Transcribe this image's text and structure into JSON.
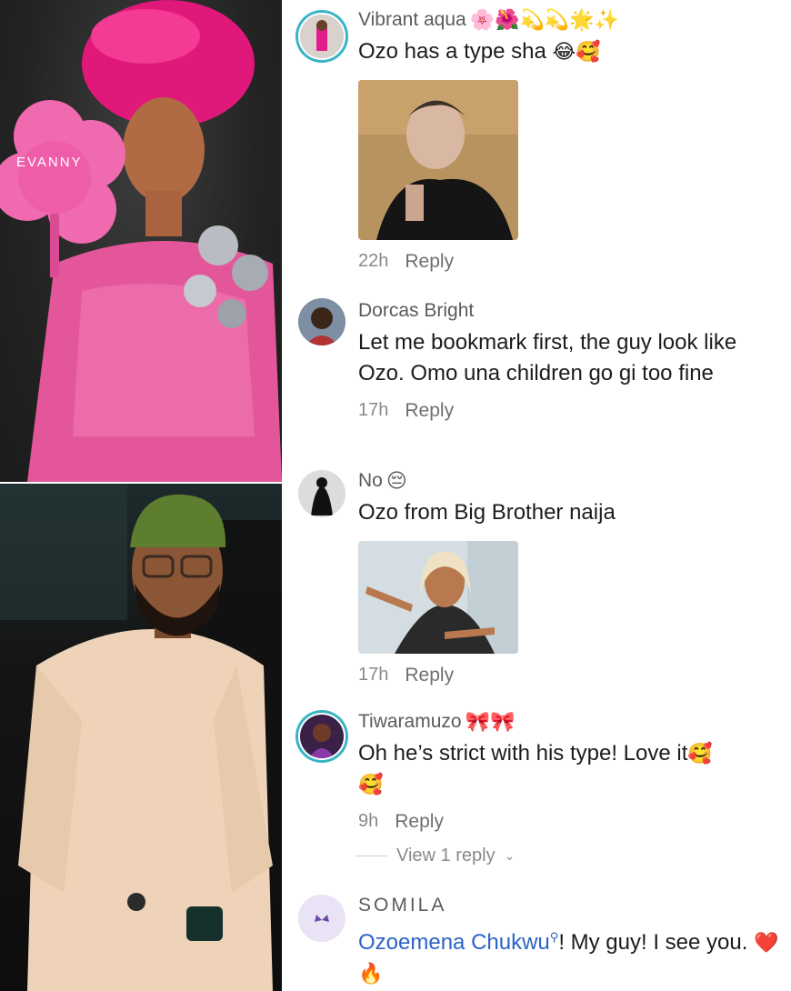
{
  "left_panel": {
    "top_photo_caption": "EVANNY"
  },
  "comments": [
    {
      "username": "Vibrant aqua",
      "username_emojis": "🌸🌺💫💫🌟✨",
      "text": "Ozo has a type sha",
      "text_emojis": "😂🥰",
      "time": "22h",
      "reply_label": "Reply"
    },
    {
      "username": "Dorcas Bright",
      "text": "Let me bookmark first, the guy look like Ozo. Omo una children go gi too fine",
      "time": "17h",
      "reply_label": "Reply"
    },
    {
      "username": "No",
      "username_emojis": "😔",
      "text": "Ozo from Big Brother naija",
      "time": "17h",
      "reply_label": "Reply"
    },
    {
      "username": "Tiwaramuzo",
      "username_emojis": "🎀🎀",
      "text": "Oh he’s strict with his type! Love it",
      "text_emojis": "🥰",
      "text_emojis_line2": "🥰",
      "time": "9h",
      "reply_label": "Reply",
      "view_replies": "View 1 reply"
    },
    {
      "username": "SOMILA",
      "mention": "Ozoemena Chukwu",
      "text": "! My guy! I see you.",
      "text_emojis": "❤️🔥"
    }
  ],
  "colors": {
    "mention": "#2b63c6",
    "story_ring": "#37b5c4",
    "meta": "#8a8a8a"
  }
}
